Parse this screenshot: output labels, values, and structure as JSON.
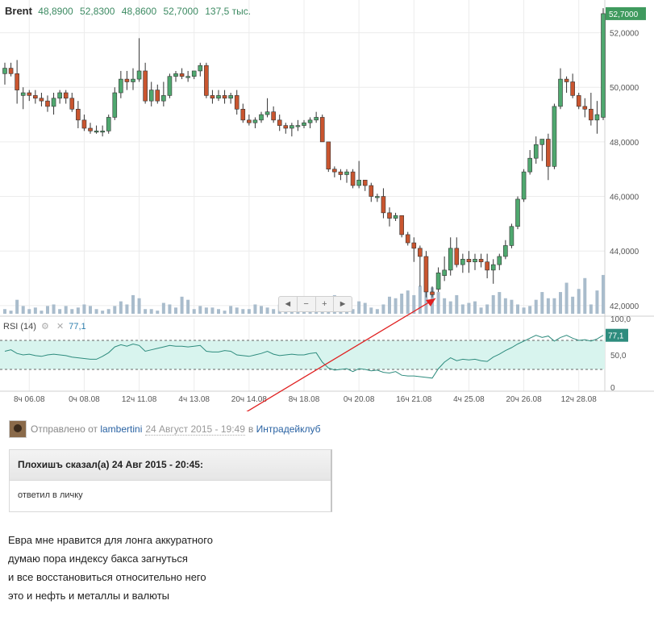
{
  "quote": {
    "symbol": "Brent",
    "open": "48,8900",
    "high": "52,8300",
    "low": "48,8600",
    "close": "52,7000",
    "volume": "137,5 тыс."
  },
  "navigator": [
    "◄",
    "−",
    "+",
    "►"
  ],
  "rsi": {
    "label": "RSI (14)",
    "value": "77,1",
    "upper": 70,
    "lower": 30
  },
  "post": {
    "sent_prefix": "Отправлено от",
    "author": "lambertini",
    "date": "24 Август 2015 - 19:49",
    "in_word": "в",
    "club": "Интрадейклуб"
  },
  "quote_block": {
    "header": "Плохишъ сказал(а) 24 Авг 2015 - 20:45:",
    "body": "ответил в личку"
  },
  "message": [
    "Евра мне нравится для лонга аккуратного",
    "думаю пора индексу бакса загнуться",
    "и все восстановиться относительно него",
    "это и нефть и металлы и валюты"
  ],
  "colors": {
    "up": "#4fa86f",
    "down": "#c9552f",
    "rsi_line": "#2e8c7e",
    "rsi_band": "#d8f4ee",
    "arrow": "#e02020",
    "last_price_tag": "#3f9a5e"
  },
  "chart_data": {
    "type": "candlestick",
    "price_axis": {
      "ticks": [
        "42,0000",
        "44,0000",
        "46,0000",
        "48,0000",
        "50,0000",
        "52,0000"
      ],
      "tick_values": [
        42,
        44,
        46,
        48,
        50,
        52
      ],
      "ylim": [
        41.7,
        53.2
      ],
      "last_price_label": "52,7000",
      "last_price": 52.7
    },
    "rsi_axis": {
      "ticks": [
        "100,0",
        "50,0",
        "0"
      ],
      "tick_values": [
        100,
        50,
        0
      ],
      "last_label": "77,1"
    },
    "time_labels": [
      "8ч 06.08",
      "0ч 08.08",
      "12ч 11.08",
      "4ч 13.08",
      "20ч 14.08",
      "8ч 18.08",
      "0ч 20.08",
      "16ч 21.08",
      "4ч 25.08",
      "20ч 26.08",
      "12ч 28.08"
    ],
    "candles": [
      [
        50.5,
        50.9,
        50.1,
        50.7
      ],
      [
        50.7,
        50.9,
        50.4,
        50.5
      ],
      [
        50.5,
        51.0,
        49.4,
        49.9
      ],
      [
        49.7,
        50.0,
        49.2,
        49.8
      ],
      [
        49.8,
        49.9,
        49.5,
        49.7
      ],
      [
        49.7,
        49.9,
        49.4,
        49.6
      ],
      [
        49.6,
        49.8,
        49.3,
        49.5
      ],
      [
        49.5,
        49.7,
        49.1,
        49.3
      ],
      [
        49.3,
        49.8,
        49.0,
        49.6
      ],
      [
        49.6,
        49.9,
        49.4,
        49.8
      ],
      [
        49.8,
        49.9,
        49.4,
        49.6
      ],
      [
        49.6,
        49.8,
        49.1,
        49.2
      ],
      [
        49.2,
        49.5,
        48.5,
        48.8
      ],
      [
        48.8,
        49.0,
        48.4,
        48.5
      ],
      [
        48.5,
        48.7,
        48.3,
        48.4
      ],
      [
        48.4,
        48.6,
        48.3,
        48.4
      ],
      [
        48.4,
        48.6,
        48.2,
        48.4
      ],
      [
        48.4,
        49.0,
        48.3,
        48.9
      ],
      [
        48.9,
        50.0,
        48.8,
        49.8
      ],
      [
        49.8,
        50.6,
        49.6,
        50.3
      ],
      [
        50.3,
        50.6,
        49.9,
        50.2
      ],
      [
        50.2,
        50.7,
        49.9,
        50.3
      ],
      [
        50.3,
        51.8,
        50.2,
        50.6
      ],
      [
        50.6,
        50.9,
        49.4,
        49.5
      ],
      [
        49.5,
        50.2,
        49.3,
        49.9
      ],
      [
        49.9,
        50.1,
        49.4,
        49.5
      ],
      [
        49.5,
        50.2,
        49.3,
        49.7
      ],
      [
        49.7,
        50.5,
        49.6,
        50.4
      ],
      [
        50.4,
        50.6,
        50.2,
        50.5
      ],
      [
        50.5,
        50.7,
        50.3,
        50.4
      ],
      [
        50.4,
        50.6,
        50.2,
        50.4
      ],
      [
        50.4,
        50.6,
        50.3,
        50.6
      ],
      [
        50.6,
        50.9,
        50.4,
        50.8
      ],
      [
        50.8,
        50.9,
        49.6,
        49.7
      ],
      [
        49.7,
        49.9,
        49.4,
        49.6
      ],
      [
        49.6,
        49.9,
        49.5,
        49.7
      ],
      [
        49.7,
        49.9,
        49.4,
        49.6
      ],
      [
        49.6,
        49.8,
        49.4,
        49.7
      ],
      [
        49.7,
        49.9,
        49.0,
        49.2
      ],
      [
        49.2,
        49.4,
        48.7,
        48.8
      ],
      [
        48.8,
        49.0,
        48.6,
        48.7
      ],
      [
        48.7,
        48.9,
        48.5,
        48.8
      ],
      [
        48.8,
        49.1,
        48.7,
        49.0
      ],
      [
        49.0,
        49.6,
        48.9,
        49.1
      ],
      [
        49.1,
        49.3,
        48.7,
        48.8
      ],
      [
        48.8,
        49.0,
        48.4,
        48.6
      ],
      [
        48.6,
        48.7,
        48.3,
        48.5
      ],
      [
        48.5,
        48.7,
        48.2,
        48.6
      ],
      [
        48.6,
        48.8,
        48.4,
        48.6
      ],
      [
        48.6,
        48.8,
        48.5,
        48.7
      ],
      [
        48.7,
        48.9,
        48.5,
        48.8
      ],
      [
        48.8,
        49.1,
        48.7,
        48.9
      ],
      [
        48.9,
        49.0,
        48.0,
        48.0
      ],
      [
        48.0,
        48.0,
        46.9,
        47.0
      ],
      [
        47.0,
        47.1,
        46.7,
        46.9
      ],
      [
        46.9,
        47.0,
        46.6,
        46.8
      ],
      [
        46.8,
        47.0,
        46.5,
        46.9
      ],
      [
        46.9,
        47.0,
        46.3,
        46.4
      ],
      [
        46.4,
        47.3,
        46.3,
        46.6
      ],
      [
        46.6,
        46.6,
        46.2,
        46.4
      ],
      [
        46.4,
        46.5,
        45.8,
        46.0
      ],
      [
        46.0,
        46.1,
        45.8,
        46.0
      ],
      [
        46.0,
        46.3,
        45.2,
        45.4
      ],
      [
        45.4,
        45.6,
        44.9,
        45.2
      ],
      [
        45.2,
        45.4,
        45.1,
        45.3
      ],
      [
        45.3,
        45.3,
        44.5,
        44.6
      ],
      [
        44.6,
        44.7,
        44.2,
        44.3
      ],
      [
        44.3,
        44.5,
        43.6,
        44.1
      ],
      [
        44.1,
        44.2,
        42.7,
        43.8
      ],
      [
        43.8,
        44.0,
        42.3,
        42.5
      ],
      [
        42.5,
        42.7,
        42.3,
        42.4
      ],
      [
        42.6,
        43.4,
        42.5,
        43.2
      ],
      [
        43.1,
        43.8,
        42.9,
        43.3
      ],
      [
        43.3,
        44.5,
        43.1,
        44.1
      ],
      [
        44.1,
        44.5,
        43.4,
        43.5
      ],
      [
        43.5,
        43.9,
        43.2,
        43.7
      ],
      [
        43.7,
        44.0,
        43.2,
        43.6
      ],
      [
        43.6,
        43.9,
        43.3,
        43.7
      ],
      [
        43.7,
        43.9,
        43.4,
        43.6
      ],
      [
        43.6,
        43.9,
        43.0,
        43.3
      ],
      [
        43.3,
        43.7,
        42.8,
        43.5
      ],
      [
        43.5,
        43.9,
        43.3,
        43.8
      ],
      [
        43.8,
        44.4,
        43.7,
        44.2
      ],
      [
        44.2,
        45.0,
        44.1,
        44.9
      ],
      [
        44.9,
        46.0,
        44.8,
        45.9
      ],
      [
        45.9,
        47.0,
        45.8,
        46.9
      ],
      [
        46.9,
        47.7,
        46.8,
        47.4
      ],
      [
        47.4,
        48.2,
        47.2,
        47.9
      ],
      [
        47.9,
        48.0,
        47.3,
        48.1
      ],
      [
        48.1,
        48.3,
        46.6,
        47.1
      ],
      [
        47.1,
        49.4,
        47.0,
        49.3
      ],
      [
        49.3,
        50.7,
        49.2,
        50.3
      ],
      [
        50.3,
        50.4,
        49.8,
        50.2
      ],
      [
        50.2,
        50.5,
        49.6,
        49.7
      ],
      [
        49.7,
        49.8,
        49.2,
        49.3
      ],
      [
        49.3,
        49.6,
        48.9,
        49.2
      ],
      [
        49.2,
        49.8,
        48.6,
        48.8
      ],
      [
        48.8,
        49.5,
        48.3,
        49.0
      ],
      [
        48.9,
        52.9,
        48.8,
        52.7
      ]
    ],
    "volume": [
      3,
      2,
      9,
      5,
      3,
      4,
      2,
      5,
      6,
      3,
      5,
      3,
      4,
      6,
      5,
      3,
      2,
      3,
      5,
      8,
      6,
      12,
      10,
      3,
      3,
      2,
      7,
      6,
      4,
      11,
      9,
      3,
      5,
      4,
      4,
      3,
      2,
      5,
      4,
      3,
      3,
      6,
      5,
      4,
      3,
      6,
      3,
      4,
      3,
      5,
      5,
      4,
      4,
      8,
      12,
      6,
      5,
      3,
      8,
      7,
      4,
      3,
      6,
      11,
      10,
      13,
      15,
      12,
      18,
      22,
      17,
      14,
      10,
      8,
      12,
      6,
      7,
      8,
      4,
      6,
      12,
      14,
      10,
      9,
      6,
      4,
      5,
      9,
      14,
      10,
      10,
      14,
      20,
      11,
      16,
      23,
      6,
      15,
      25
    ],
    "rsi": [
      55,
      57,
      52,
      50,
      51,
      49,
      48,
      50,
      51,
      50,
      49,
      47,
      46,
      45,
      44,
      44,
      48,
      53,
      61,
      64,
      62,
      65,
      63,
      55,
      57,
      59,
      61,
      63,
      62,
      62,
      61,
      62,
      63,
      55,
      54,
      54,
      56,
      55,
      50,
      49,
      48,
      50,
      52,
      55,
      51,
      49,
      50,
      51,
      50,
      50,
      52,
      53,
      40,
      32,
      29,
      30,
      31,
      27,
      31,
      30,
      28,
      29,
      26,
      25,
      27,
      22,
      21,
      21,
      20,
      19,
      18,
      31,
      40,
      46,
      42,
      44,
      43,
      44,
      42,
      41,
      47,
      51,
      56,
      60,
      65,
      69,
      73,
      77,
      74,
      76,
      69,
      74,
      77,
      73,
      70,
      71,
      69,
      72,
      77
    ],
    "annotation": "arrow from post to 24.08 low"
  }
}
